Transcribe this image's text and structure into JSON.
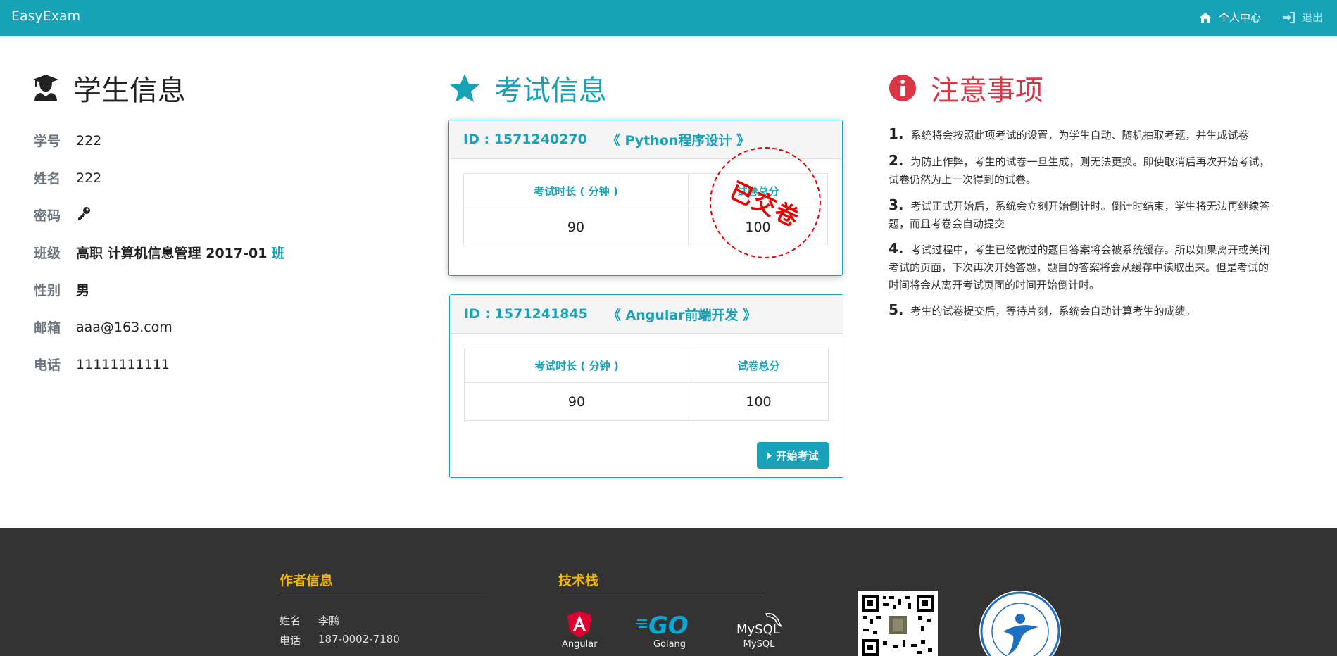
{
  "navbar": {
    "brand": "EasyExam",
    "personal_center": "个人中心",
    "logout": "退出"
  },
  "student": {
    "title": "学生信息",
    "rows": [
      {
        "label": "学号",
        "value": "222"
      },
      {
        "label": "姓名",
        "value": "222"
      },
      {
        "label": "密码",
        "value": ""
      },
      {
        "label": "班级",
        "value": "高职 计算机信息管理 2017-01",
        "suffix": "班"
      },
      {
        "label": "性别",
        "value": "男"
      },
      {
        "label": "邮箱",
        "value": "aaa@163.com"
      },
      {
        "label": "电话",
        "value": "11111111111"
      }
    ]
  },
  "exams": {
    "title": "考试信息",
    "duration_header": "考试时长 ( 分钟 )",
    "score_header": "试卷总分",
    "items": [
      {
        "id": "ID : 1571240270",
        "name": "《 Python程序设计 》",
        "duration": "90",
        "score": "100",
        "stamp": "已交卷"
      },
      {
        "id": "ID : 1571241845",
        "name": "《 Angular前端开发 》",
        "duration": "90",
        "score": "100",
        "button": "开始考试"
      }
    ]
  },
  "notice": {
    "title": "注意事项",
    "items": [
      {
        "num": "1.",
        "text": "系统将会按照此项考试的设置，为学生自动、随机抽取考题，并生成试卷"
      },
      {
        "num": "2.",
        "text": "为防止作弊，考生的试卷一旦生成，则无法更换。即使取消后再次开始考试，试卷仍然为上一次得到的试卷。"
      },
      {
        "num": "3.",
        "text": "考试正式开始后，系统会立刻开始倒计时。倒计时结束，学生将无法再继续答题，而且考卷会自动提交"
      },
      {
        "num": "4.",
        "text": "考试过程中，考生已经做过的题目答案将会被系统缓存。所以如果离开或关闭考试的页面，下次再次开始答题，题目的答案将会从缓存中读取出来。但是考试的时间将会从离开考试页面的时间开始倒计时。"
      },
      {
        "num": "5.",
        "text": "考生的试卷提交后，等待片刻，系统会自动计算考生的成绩。"
      }
    ]
  },
  "footer": {
    "author_heading": "作者信息",
    "author_rows": [
      {
        "k": "姓名",
        "v": "李鹏"
      },
      {
        "k": "电话",
        "v": "187-0002-7180"
      }
    ],
    "tech_heading": "技术栈",
    "tech": [
      "Angular",
      "Golang",
      "MySQL"
    ]
  },
  "colors": {
    "primary": "#17a2b8",
    "danger": "#dc3545",
    "footer_bg": "#333333",
    "footer_heading": "#f5b800",
    "stamp": "#ee0000"
  }
}
